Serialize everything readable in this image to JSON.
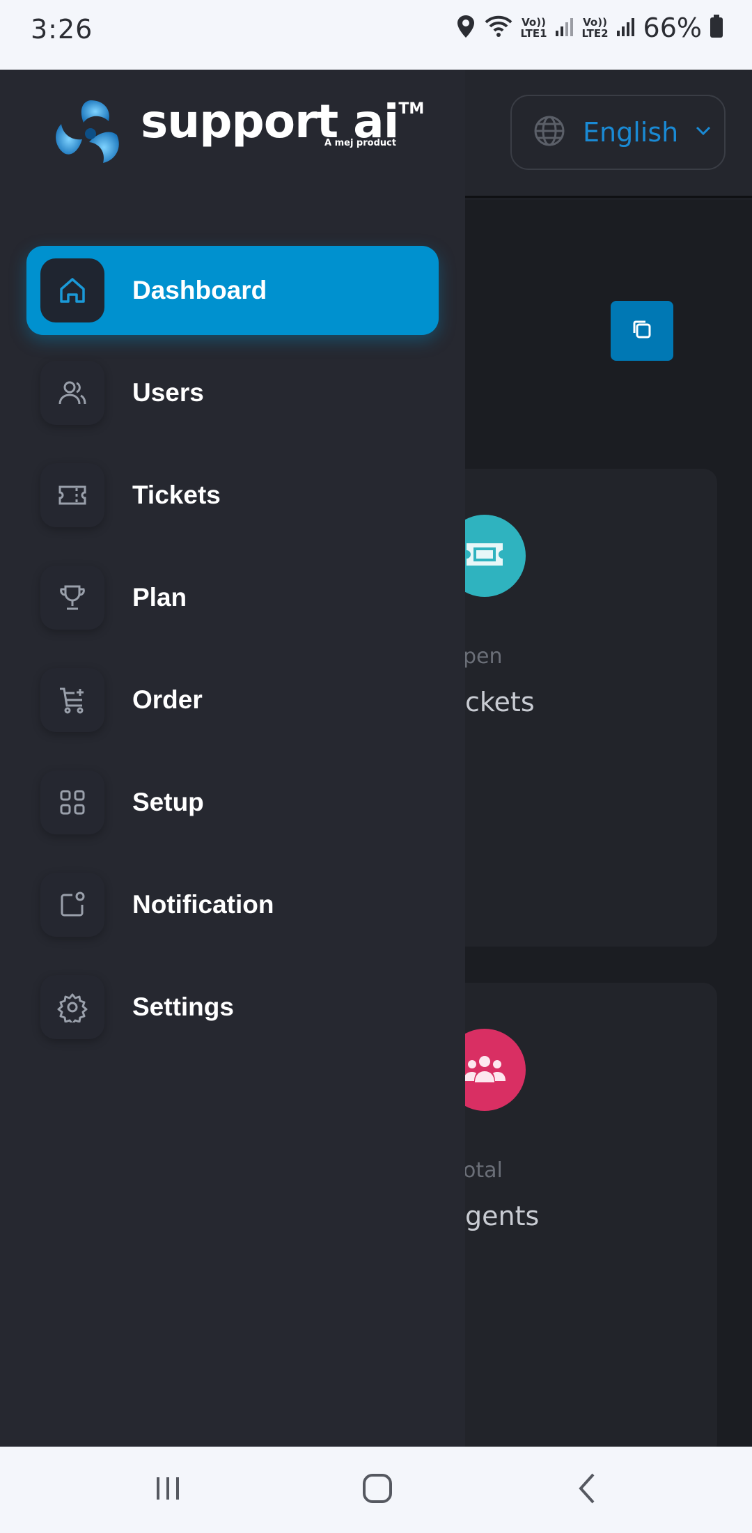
{
  "status_bar": {
    "time": "3:26",
    "sim1": "Vo))\nLTE1",
    "sim2": "Vo))\nLTE2",
    "battery": "66%",
    "icons": [
      "location-icon",
      "wifi-icon",
      "signal-icon",
      "battery-icon"
    ]
  },
  "header": {
    "language": "English"
  },
  "logo": {
    "brand": "support ai",
    "trademark": "TM",
    "tagline": "A mej product"
  },
  "sidebar": {
    "items": [
      {
        "label": "Dashboard",
        "icon": "home-icon",
        "active": true
      },
      {
        "label": "Users",
        "icon": "users-icon",
        "active": false
      },
      {
        "label": "Tickets",
        "icon": "ticket-icon",
        "active": false
      },
      {
        "label": "Plan",
        "icon": "trophy-icon",
        "active": false
      },
      {
        "label": "Order",
        "icon": "cart-icon",
        "active": false
      },
      {
        "label": "Setup",
        "icon": "grid-icon",
        "active": false
      },
      {
        "label": "Notification",
        "icon": "notification-icon",
        "active": false
      },
      {
        "label": "Settings",
        "icon": "gear-icon",
        "active": false
      }
    ]
  },
  "cards": [
    {
      "small_label": "pen",
      "big_label": "ckets",
      "color": "#2fb3bf"
    },
    {
      "small_label": "otal",
      "big_label": "gents",
      "color": "#d92f63"
    }
  ],
  "colors": {
    "accent": "#0091cf",
    "drawer_bg": "#262830",
    "page_bg": "#1b1d22"
  }
}
